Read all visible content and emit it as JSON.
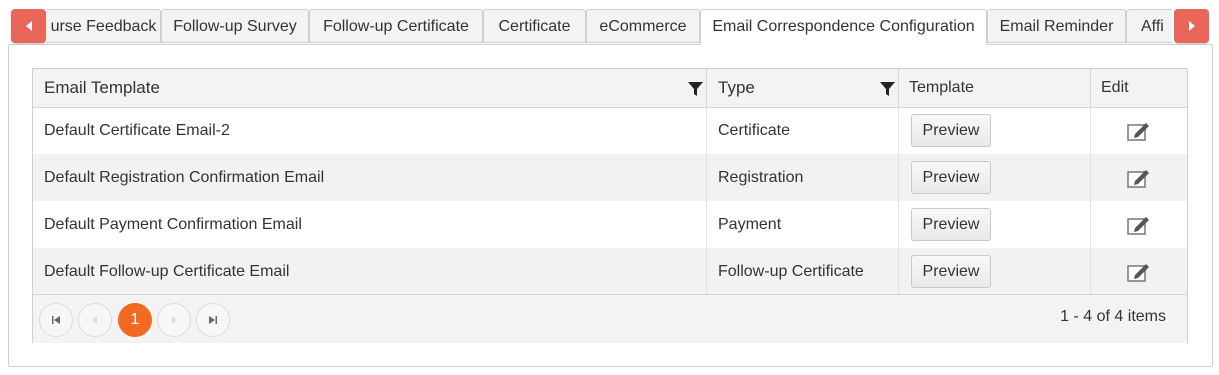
{
  "tabs": [
    {
      "label": "urse Feedback"
    },
    {
      "label": "Follow-up Survey"
    },
    {
      "label": "Follow-up Certificate"
    },
    {
      "label": "Certificate"
    },
    {
      "label": "eCommerce"
    },
    {
      "label": "Email Correspondence Configuration",
      "active": true
    },
    {
      "label": "Email Reminder"
    },
    {
      "label": "Affi"
    }
  ],
  "grid": {
    "columns": [
      "Email Template",
      "Type",
      "Template",
      "Edit"
    ],
    "rows": [
      {
        "template": "Default Certificate Email-2",
        "type": "Certificate",
        "action": "Preview"
      },
      {
        "template": "Default Registration Confirmation Email",
        "type": "Registration",
        "action": "Preview"
      },
      {
        "template": "Default Payment Confirmation Email",
        "type": "Payment",
        "action": "Preview"
      },
      {
        "template": "Default Follow-up Certificate Email",
        "type": "Follow-up Certificate",
        "action": "Preview"
      }
    ]
  },
  "pager": {
    "current_page": "1",
    "info": "1 - 4 of 4 items"
  },
  "colors": {
    "accent": "#e8675a",
    "current_page": "#f26a21"
  },
  "icons": [
    "chevron-left-icon",
    "chevron-right-icon",
    "filter-icon",
    "edit-icon",
    "first-page-icon",
    "prev-page-icon",
    "next-page-icon",
    "last-page-icon"
  ]
}
